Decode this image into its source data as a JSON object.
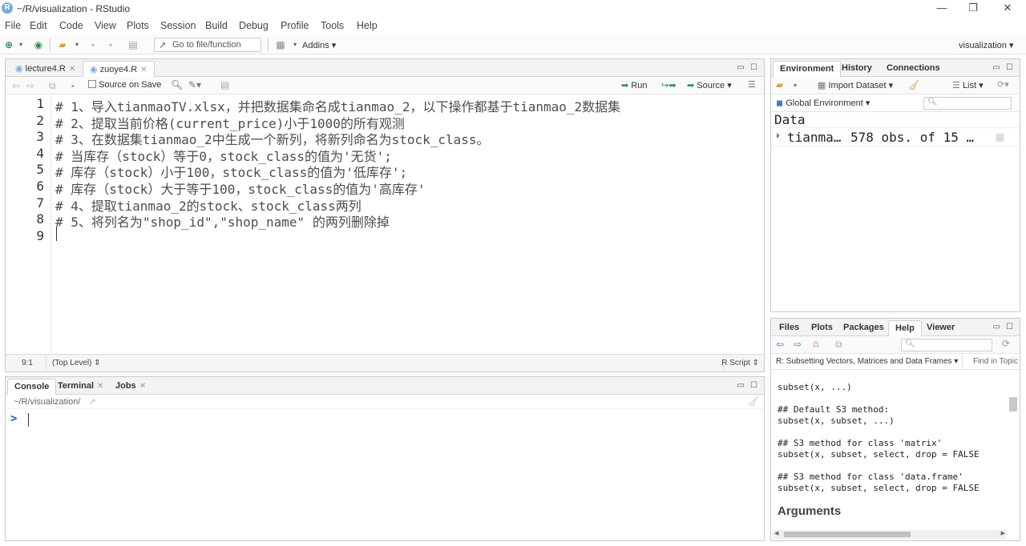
{
  "window": {
    "title": "~/R/visualization - RStudio",
    "logo": "R"
  },
  "menu": [
    "File",
    "Edit",
    "Code",
    "View",
    "Plots",
    "Session",
    "Build",
    "Debug",
    "Profile",
    "Tools",
    "Help"
  ],
  "toolbar": {
    "goto_placeholder": "Go to file/function",
    "addins": "Addins",
    "project": "visualization"
  },
  "editor": {
    "tabs": [
      "lecture4.R",
      "zuoye4.R"
    ],
    "source_on_save": "Source on Save",
    "run": "Run",
    "source": "Source",
    "lines": [
      "# 1、导入tianmaoTV.xlsx，并把数据集命名成tianmao_2，以下操作都基于tianmao_2数据集",
      "# 2、提取当前价格(current_price)小于1000的所有观测",
      "# 3、在数据集tianmao_2中生成一个新列，将新列命名为stock_class。",
      "# 当库存（stock）等于0，stock_class的值为'无货';",
      "# 库存（stock）小于100，stock_class的值为'低库存';",
      "# 库存（stock）大于等于100，stock_class的值为'高库存'",
      "# 4、提取tianmao_2的stock、stock_class两列",
      "# 5、将列名为\"shop_id\",\"shop_name\" 的两列删除掉",
      ""
    ],
    "line_numbers": [
      "1",
      "2",
      "3",
      "4",
      "5",
      "6",
      "7",
      "8",
      "9"
    ],
    "status_pos": "9:1",
    "status_scope": "(Top Level)",
    "status_type": "R Script"
  },
  "console": {
    "tabs": [
      "Console",
      "Terminal",
      "Jobs"
    ],
    "path": "~/R/visualization/",
    "prompt": ">"
  },
  "environment": {
    "tabs": [
      "Environment",
      "History",
      "Connections"
    ],
    "import_dataset": "Import Dataset",
    "list": "List",
    "scope": "Global Environment",
    "section": "Data",
    "rows": [
      {
        "name": "tianma…",
        "value": "578 obs. of 15 …"
      }
    ]
  },
  "files": {
    "tabs": [
      "Files",
      "Plots",
      "Packages",
      "Help",
      "Viewer"
    ],
    "help_topic": "R: Subsetting Vectors, Matrices and Data Frames",
    "find_in_topic": "Find in Topic",
    "help_lines": [
      "subset(x, ...)",
      "",
      "## Default S3 method:",
      "subset(x, subset, ...)",
      "",
      "## S3 method for class 'matrix'",
      "subset(x, subset, select, drop = FALSE",
      "",
      "## S3 method for class 'data.frame'",
      "subset(x, subset, select, drop = FALSE"
    ],
    "arguments_heading": "Arguments"
  },
  "colors": {
    "accent": "#75aadb",
    "prompt": "#1a5fb4",
    "run_green": "#2e8b57"
  }
}
